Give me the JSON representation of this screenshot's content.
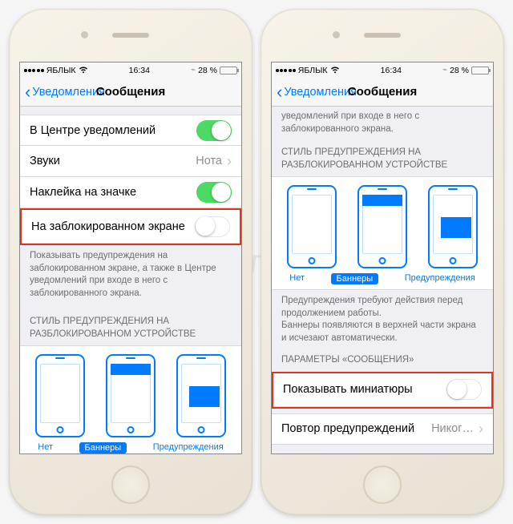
{
  "watermark": "Яблык",
  "status": {
    "carrier": "ЯБЛЫК",
    "time": "16:34",
    "battery_pct": "28 %"
  },
  "nav": {
    "back": "Уведомления",
    "title": "Сообщения"
  },
  "left": {
    "rows": {
      "nc": "В Центре уведомлений",
      "sounds": "Звуки",
      "sounds_value": "Нота",
      "badge": "Наклейка на значке",
      "lockscreen": "На заблокированном экране"
    },
    "footer": "Показывать предупреждения на заблокированном экране, а также в Центре уведомлений при входе в него с заблокированного экрана.",
    "style_header": "СТИЛЬ ПРЕДУПРЕЖДЕНИЯ НА РАЗБЛОКИРОВАННОМ УСТРОЙСТВЕ",
    "styles": {
      "none": "Нет",
      "banners": "Баннеры",
      "alerts": "Предупреждения"
    }
  },
  "right": {
    "top_footer": "уведомлений при входе в него с заблокированного экрана.",
    "style_header": "СТИЛЬ ПРЕДУПРЕЖДЕНИЯ НА РАЗБЛОКИРОВАННОМ УСТРОЙСТВЕ",
    "styles": {
      "none": "Нет",
      "banners": "Баннеры",
      "alerts": "Предупреждения"
    },
    "style_footer": "Предупреждения требуют действия перед продолжением работы.\nБаннеры появляются в верхней части экрана и исчезают автоматически.",
    "params_header": "ПАРАМЕТРЫ «СООБЩЕНИЯ»",
    "thumbs": "Показывать миниатюры",
    "repeat": "Повтор предупреждений",
    "repeat_value": "Никог…"
  }
}
